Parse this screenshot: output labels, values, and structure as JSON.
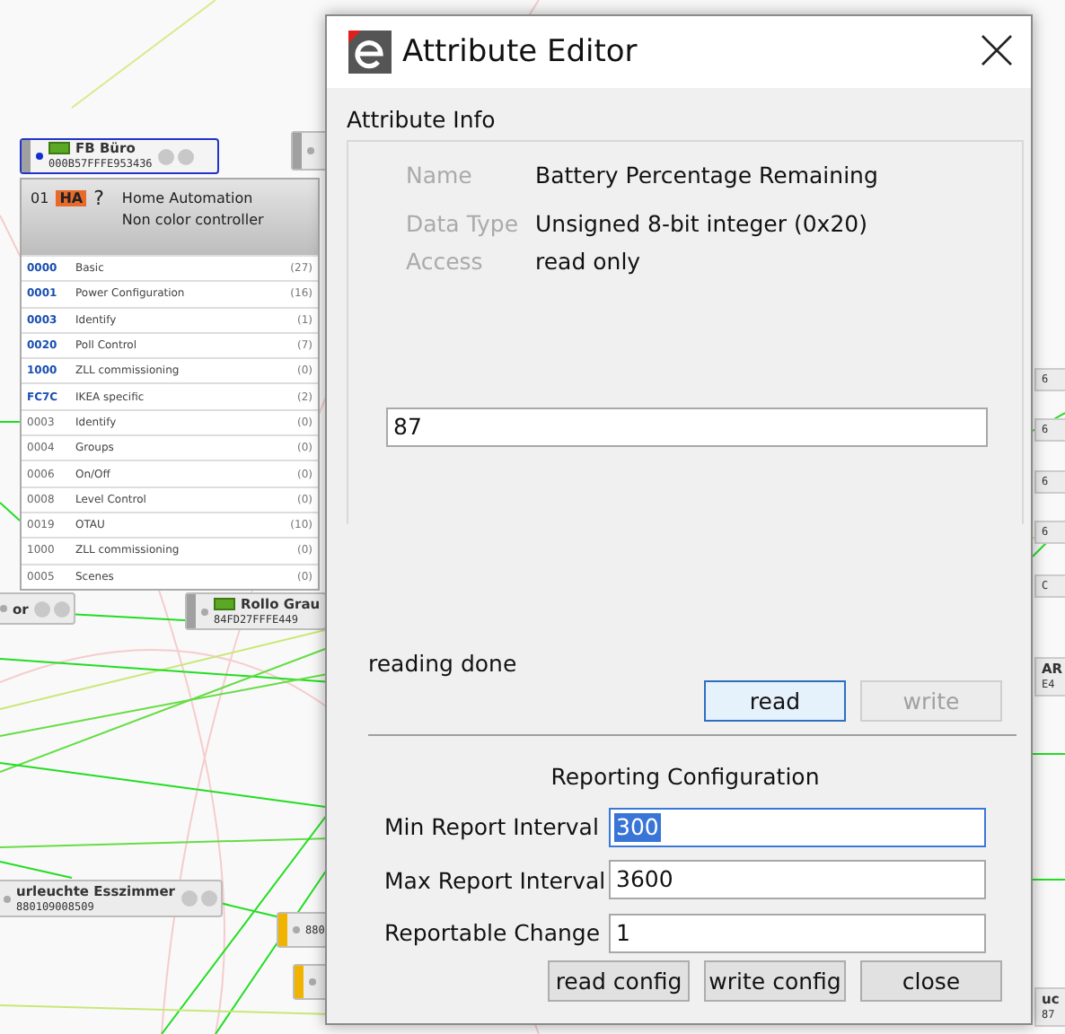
{
  "canvas": {
    "nodes": [
      {
        "kind": "device",
        "name": "FB Büro",
        "address": "000B57FFFE953436",
        "color": "#a0a0a0",
        "selected": true,
        "battery": true
      },
      {
        "kind": "device",
        "color": "#a0a0a0",
        "selected": false,
        "battery": false
      },
      {
        "kind": "device",
        "name": "or",
        "selected": false,
        "battery": false
      },
      {
        "kind": "device",
        "name": "Rollo Grau",
        "address": "84FD27FFFE449",
        "color": "#a0a0a0",
        "selected": false,
        "battery": true
      },
      {
        "kind": "device",
        "name": "urleuchte Esszimmer",
        "address": "880109008509",
        "selected": false,
        "battery": false
      },
      {
        "kind": "device",
        "address": "880",
        "color": "#f0b400",
        "selected": false,
        "battery": false
      },
      {
        "kind": "device",
        "color": "#f0b400",
        "selected": false,
        "battery": false
      },
      {
        "kind": "fragment",
        "address": "6"
      },
      {
        "kind": "fragment",
        "address": "6"
      },
      {
        "kind": "fragment",
        "address": "6"
      },
      {
        "kind": "fragment",
        "address": "6"
      },
      {
        "kind": "fragment",
        "address": "C"
      },
      {
        "kind": "fragment",
        "name": "AR",
        "address": "E4"
      },
      {
        "kind": "fragment",
        "name": "uc",
        "address": "87"
      }
    ],
    "cluster_panel": {
      "endpoint": "01",
      "profile": "HA",
      "status": "?",
      "lines": [
        "Home Automation",
        "Non color controller"
      ],
      "clusters": [
        {
          "id": "0000",
          "name": "Basic",
          "count": "(27)",
          "kind": "server"
        },
        {
          "id": "0001",
          "name": "Power Configuration",
          "count": "(16)",
          "kind": "server"
        },
        {
          "id": "0003",
          "name": "Identify",
          "count": "(1)",
          "kind": "server"
        },
        {
          "id": "0020",
          "name": "Poll Control",
          "count": "(7)",
          "kind": "server"
        },
        {
          "id": "1000",
          "name": "ZLL commissioning",
          "count": "(0)",
          "kind": "server"
        },
        {
          "id": "FC7C",
          "name": "IKEA specific",
          "count": "(2)",
          "kind": "server"
        },
        {
          "id": "0003",
          "name": "Identify",
          "count": "(0)",
          "kind": "client"
        },
        {
          "id": "0004",
          "name": "Groups",
          "count": "(0)",
          "kind": "client"
        },
        {
          "id": "0006",
          "name": "On/Off",
          "count": "(0)",
          "kind": "client"
        },
        {
          "id": "0008",
          "name": "Level Control",
          "count": "(0)",
          "kind": "client"
        },
        {
          "id": "0019",
          "name": "OTAU",
          "count": "(10)",
          "kind": "client"
        },
        {
          "id": "1000",
          "name": "ZLL commissioning",
          "count": "(0)",
          "kind": "client"
        },
        {
          "id": "0005",
          "name": "Scenes",
          "count": "(0)",
          "kind": "client"
        }
      ]
    }
  },
  "dialog": {
    "title": "Attribute Editor",
    "info": {
      "heading": "Attribute Info",
      "fields": [
        {
          "label": "Name",
          "value": "Battery Percentage Remaining"
        },
        {
          "label": "Data Type",
          "value": "Unsigned 8-bit integer (0x20)"
        },
        {
          "label": "Access",
          "value": "read only"
        }
      ],
      "value": "87",
      "status": "reading done",
      "buttons": [
        {
          "label": "read",
          "focused": true,
          "disabled": false
        },
        {
          "label": "write",
          "focused": false,
          "disabled": true
        }
      ]
    },
    "reporting": {
      "heading": "Reporting Configuration",
      "fields": [
        {
          "label": "Min Report Interval",
          "value": "300",
          "focused": true
        },
        {
          "label": "Max Report Interval",
          "value": "3600",
          "focused": false
        },
        {
          "label": "Reportable Change",
          "value": "1",
          "focused": false
        }
      ]
    },
    "buttons": [
      "read config",
      "write config",
      "close"
    ]
  }
}
